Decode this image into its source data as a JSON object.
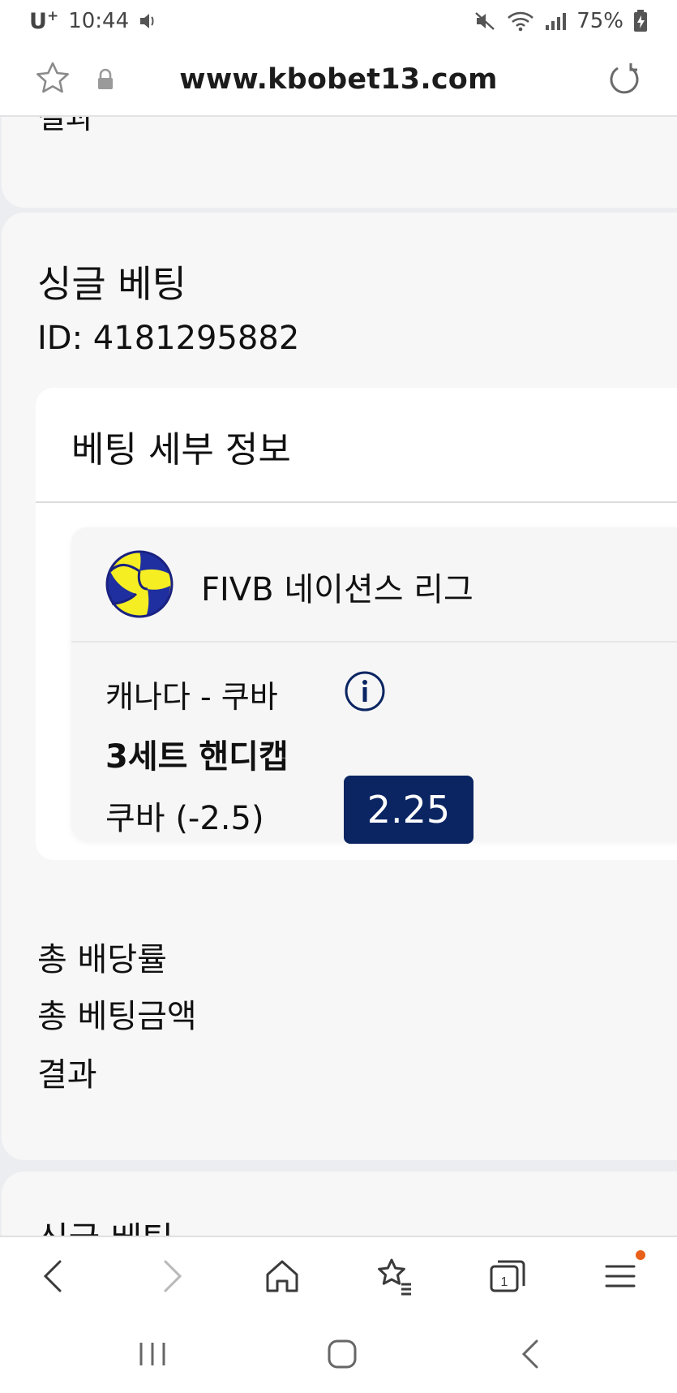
{
  "status_bar": {
    "carrier": "U",
    "carrier_sup": "+",
    "time": "10:44",
    "battery": "75%"
  },
  "url_bar": {
    "url": "www.kbobet13.com"
  },
  "prev_card": {
    "title": "결과"
  },
  "bet": {
    "type": "싱글 베팅",
    "id": "ID: 4181295882",
    "details_title": "베팅 세부 정보",
    "league": "FIVB 네이션스 리그",
    "league_icon": "volleyball-icon",
    "match": "캐나다 - 쿠바",
    "market": "3세트 핸디캡",
    "selection": "쿠바 (-2.5)",
    "odds": "2.25",
    "summary": {
      "total_odds_label": "총 배당률",
      "total_stake_label": "총 베팅금액",
      "result_label": "결과"
    }
  },
  "next_card": {
    "title": "싱글 베팅"
  },
  "colors": {
    "odds_bg": "#0b2563",
    "accent_dot": "#e8601a"
  }
}
